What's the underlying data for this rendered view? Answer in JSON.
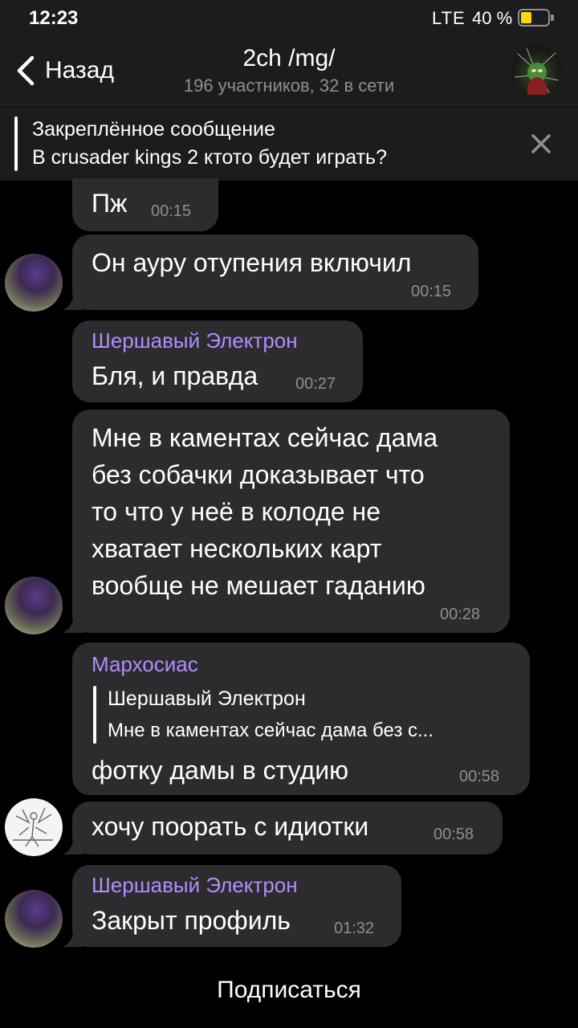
{
  "status": {
    "time": "12:23",
    "network": "LTE",
    "battery": "40 %",
    "battery_level": 0.4
  },
  "header": {
    "back_label": "Назад",
    "title": "2ch /mg/",
    "subtitle": "196 участников, 32 в сети"
  },
  "pinned": {
    "title": "Закреплённое сообщение",
    "text": "В crusader kings 2 ктото будет играть?"
  },
  "messages": [
    {
      "text": "Пж",
      "time": "00:15"
    },
    {
      "text": "Он ауру отупения включил",
      "time": "00:15"
    },
    {
      "sender": "Шершавый Электрон",
      "text": "Бля, и правда",
      "time": "00:27"
    },
    {
      "lines": [
        "Мне в каментах сейчас дама",
        "без собачки доказывает что",
        "то что у неё в колоде не",
        "хватает нескольких карт",
        "вообще не мешает гаданию"
      ],
      "time": "00:28"
    },
    {
      "sender": "Мархосиас",
      "reply_sender": "Шершавый Электрон",
      "reply_text": "Мне в каментах сейчас дама без с...",
      "text": "фотку дамы в студию",
      "time": "00:58"
    },
    {
      "text": "хочу поорать с идиотки",
      "time": "00:58"
    },
    {
      "sender": "Шершавый Электрон",
      "text": "Закрыт профиль",
      "time": "01:32"
    }
  ],
  "footer": {
    "subscribe_label": "Подписаться"
  },
  "colors": {
    "bubble": "#2c2c2e",
    "sender": "#b28cff",
    "background": "#000000",
    "bar": "#1c1c1e"
  }
}
